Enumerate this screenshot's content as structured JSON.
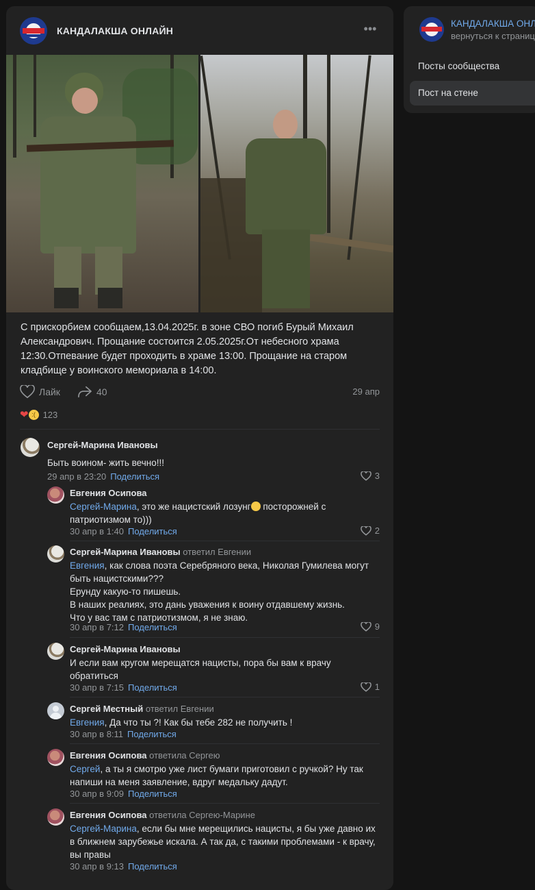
{
  "post": {
    "community_name": "КАНДАЛАКША ОНЛАЙН",
    "logo_text": "КАНДАЛАКША",
    "logo_subtext": "ОНЛАЙН",
    "text": "С прискорбием сообщаем,13.04.2025г. в зоне СВО погиб Бурый Михаил Александрович. Прощание состоится 2.05.2025г.От небесного храма 12:30.Отпевание будет проходить в храме 13:00. Прощание на старом кладбище у воинского мемориала в 14:00.",
    "like_label": "Лайк",
    "share_count": "40",
    "date": "29 апр",
    "reactions_count": "123"
  },
  "comments": [
    {
      "author": "Сергей-Марина Ивановы",
      "replied": "",
      "mention": "",
      "text": "Быть воином- жить вечно!!!",
      "time": "29 апр в 23:20",
      "share": "Поделиться",
      "likes": "3"
    },
    {
      "author": "Евгения Осипова",
      "replied": "",
      "mention": "Сергей-Марина",
      "text_a": ", это же нацистский лозунг",
      "text_b": " посторожней с патриотизмом то)))",
      "time": "30 апр в 1:40",
      "share": "Поделиться",
      "likes": "2"
    },
    {
      "author": "Сергей-Марина Ивановы",
      "replied": "ответил Евгении",
      "mention": "Евгения",
      "text_lines": [
        ", как слова поэта Серебряного века, Николая Гумилева могут быть нацистскими???",
        "Ерунду какую-то пишешь.",
        "В наших реалиях, это дань уважения к воину отдавшему жизнь.",
        "Что у вас там с патриотизмом, я не знаю."
      ],
      "time": "30 апр в 7:12",
      "share": "Поделиться",
      "likes": "9"
    },
    {
      "author": "Сергей-Марина Ивановы",
      "replied": "",
      "mention": "",
      "text": "И если вам кругом мерещатся нацисты, пора бы вам к врачу обратиться",
      "time": "30 апр в 7:15",
      "share": "Поделиться",
      "likes": "1"
    },
    {
      "author": "Сергей Местный",
      "replied": "ответил Евгении",
      "mention": "Евгения",
      "text": ", Да что ты ?! Как бы тебе 282 не получить !",
      "time": "30 апр в 8:11",
      "share": "Поделиться",
      "likes": ""
    },
    {
      "author": "Евгения Осипова",
      "replied": "ответила Сергею",
      "mention": "Сергей",
      "text": ", а ты я смотрю уже лист бумаги приготовил с ручкой? Ну так напиши на меня заявление, вдруг медальку дадут.",
      "time": "30 апр в 9:09",
      "share": "Поделиться",
      "likes": ""
    },
    {
      "author": "Евгения Осипова",
      "replied": "ответила Сергею-Марине",
      "mention": "Сергей-Марина",
      "text": ", если бы мне мерещились нацисты, я бы уже давно их в ближнем зарубежье искала. А так да, с такими проблемами - к врачу, вы правы",
      "time": "30 апр в 9:13",
      "share": "Поделиться",
      "likes": ""
    }
  ],
  "sidebar": {
    "name": "КАНДАЛАКША ОНЛАЙН",
    "back_link": "вернуться к странице",
    "items": [
      "Посты сообщества",
      "Пост на стене"
    ]
  },
  "colors": {
    "background": "#141414",
    "card": "#222222",
    "link": "#71aaeb",
    "muted": "#939699"
  }
}
